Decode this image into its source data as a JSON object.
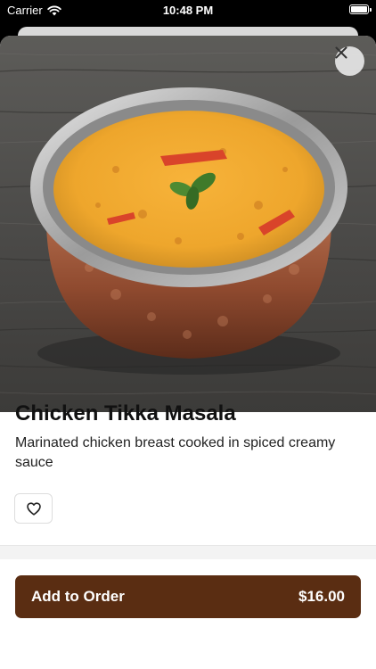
{
  "status_bar": {
    "carrier": "Carrier",
    "time": "10:48 PM"
  },
  "item": {
    "name": "Chicken Tikka Masala",
    "description": "Marinated chicken breast cooked in spiced creamy sauce"
  },
  "actions": {
    "add_label": "Add to Order",
    "price": "$16.00"
  },
  "colors": {
    "accent": "#5a2d12",
    "icon": "#222222"
  },
  "icons": {
    "close": "close-icon",
    "favorite": "heart-icon",
    "wifi": "wifi-icon",
    "battery": "battery-icon"
  }
}
